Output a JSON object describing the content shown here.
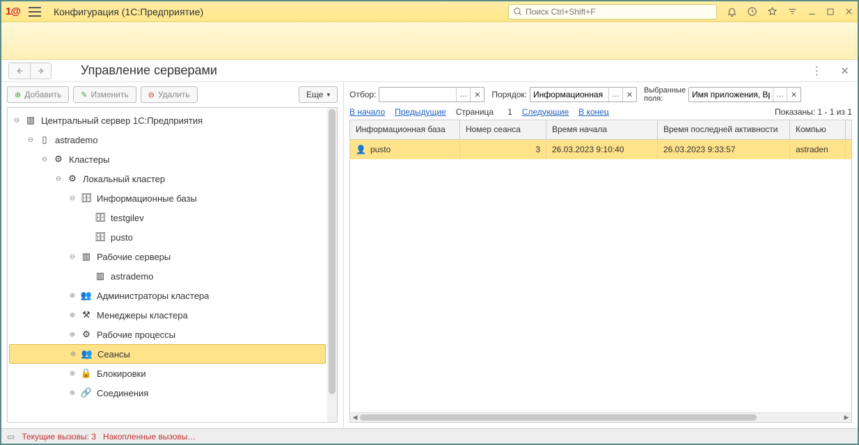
{
  "titlebar": {
    "app_title": "Конфигурация  (1С:Предприятие)",
    "search_placeholder": "Поиск Ctrl+Shift+F"
  },
  "subheader": {
    "page_title": "Управление серверами"
  },
  "left_toolbar": {
    "add": "Добавить",
    "edit": "Изменить",
    "delete": "Удалить",
    "more": "Еще"
  },
  "tree": {
    "root": "Центральный сервер 1С:Предприятия",
    "n1": "astrademo",
    "n2": "Кластеры",
    "n3": "Локальный кластер",
    "n4": "Информационные базы",
    "n5": "testgilev",
    "n6": "pusto",
    "n7": "Рабочие серверы",
    "n8": "astrademo",
    "n9": "Администраторы кластера",
    "n10": "Менеджеры кластера",
    "n11": "Рабочие процессы",
    "n12": "Сеансы",
    "n13": "Блокировки",
    "n14": "Соединения"
  },
  "filters": {
    "filter_label": "Отбор:",
    "filter_value": "",
    "order_label": "Порядок:",
    "order_value": "Информационная б",
    "fields_label1": "Выбранные",
    "fields_label2": "поля:",
    "fields_value": "Имя приложения, Вре"
  },
  "pager": {
    "first": "В начало",
    "prev": "Предыдущие",
    "page_label": "Страница",
    "page_num": "1",
    "next": "Следующие",
    "last": "В конец",
    "shown": "Показаны: 1 - 1 из 1"
  },
  "table": {
    "headers": {
      "c0": "Информационная база",
      "c1": "Номер сеанса",
      "c2": "Время начала",
      "c3": "Время последней активности",
      "c4": "Компью"
    },
    "row0": {
      "c0": "pusto",
      "c1": "3",
      "c2": "26.03.2023 9:10:40",
      "c3": "26.03.2023 9:33:57",
      "c4": "astraden"
    }
  },
  "status": {
    "calls": "Текущие вызовы: 3",
    "acc": "Накопленные вызовы…"
  }
}
